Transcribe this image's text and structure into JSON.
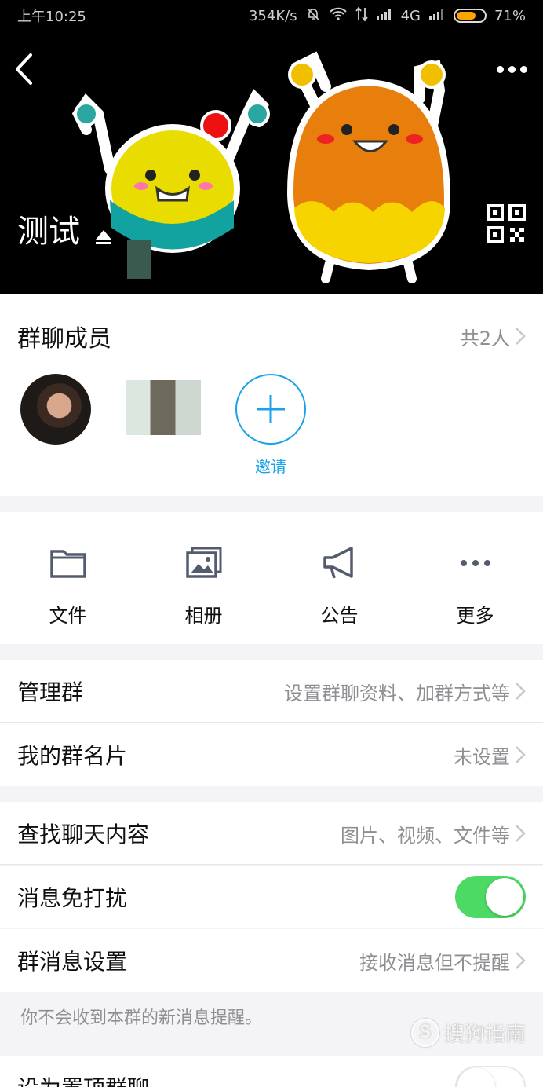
{
  "status_bar": {
    "time": "上午10:25",
    "speed": "354K/s",
    "network": "4G",
    "battery": "71%",
    "battery_level": 0.71,
    "icons": [
      "mute-bell-icon",
      "wifi-icon",
      "data-arrows-icon",
      "signal-icon",
      "signal-icon",
      "battery-icon"
    ]
  },
  "header": {
    "group_name": "测试",
    "icons": [
      "back-icon",
      "more-dots-icon",
      "edit-icon",
      "qr-code-icon"
    ]
  },
  "members": {
    "title": "群聊成员",
    "count": "共2人",
    "invite_label": "邀请"
  },
  "tools": [
    {
      "label": "文件",
      "icon": "folder-icon"
    },
    {
      "label": "相册",
      "icon": "album-icon"
    },
    {
      "label": "公告",
      "icon": "megaphone-icon"
    },
    {
      "label": "更多",
      "icon": "more-dots-icon"
    }
  ],
  "settings": {
    "manage": {
      "title": "管理群",
      "value": "设置群聊资料、加群方式等"
    },
    "card": {
      "title": "我的群名片",
      "value": "未设置"
    },
    "search": {
      "title": "查找聊天内容",
      "value": "图片、视频、文件等"
    },
    "dnd": {
      "title": "消息免打扰",
      "enabled": true
    },
    "msg": {
      "title": "群消息设置",
      "value": "接收消息但不提醒"
    },
    "hint": "你不会收到本群的新消息提醒。",
    "pin": {
      "title": "设为置顶群聊",
      "enabled": false
    }
  },
  "watermark": {
    "badge": "S",
    "text": "搜狗指南"
  },
  "colors": {
    "accent": "#1aa3e8",
    "toggle_on": "#4cd964",
    "battery": "#ffa300"
  }
}
